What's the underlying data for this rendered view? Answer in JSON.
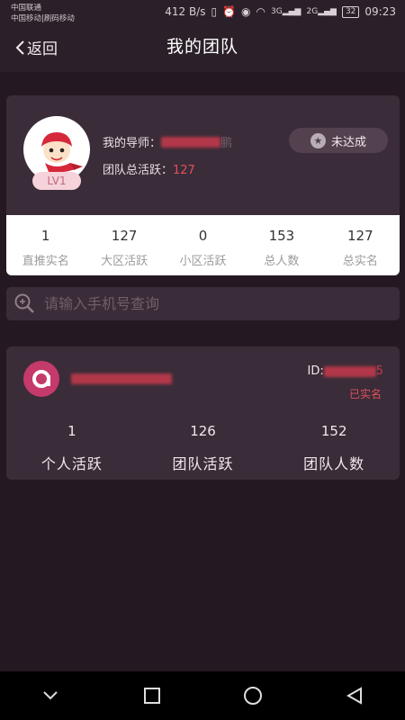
{
  "status_bar": {
    "carrier1": "中国联通",
    "carrier2": "中国移动|刷码移动",
    "net_speed": "412 B/s",
    "signal1": "3G",
    "signal2": "2G",
    "battery": "32",
    "time": "09:23"
  },
  "nav": {
    "back_label": "返回",
    "title": "我的团队"
  },
  "profile": {
    "mentor_label": "我的导师：",
    "mentor_tail": "鹏",
    "team_active_label": "团队总活跃：",
    "team_active_value": "127",
    "level": "LV1",
    "status_button": "未达成"
  },
  "stats": [
    {
      "value": "1",
      "label": "直推实名"
    },
    {
      "value": "127",
      "label": "大区活跃"
    },
    {
      "value": "0",
      "label": "小区活跃"
    },
    {
      "value": "153",
      "label": "总人数"
    },
    {
      "value": "127",
      "label": "总实名"
    }
  ],
  "search": {
    "placeholder": "请输入手机号查询"
  },
  "member": {
    "id_label": "ID:",
    "id_tail": "5",
    "verified": "已实名",
    "stats": [
      {
        "value": "1",
        "label": "个人活跃"
      },
      {
        "value": "126",
        "label": "团队活跃"
      },
      {
        "value": "152",
        "label": "团队人数"
      }
    ]
  },
  "colors": {
    "background": "#241923",
    "card": "#3a2c38",
    "accent_red": "#e0505e",
    "logo_pink": "#c43a6a"
  }
}
